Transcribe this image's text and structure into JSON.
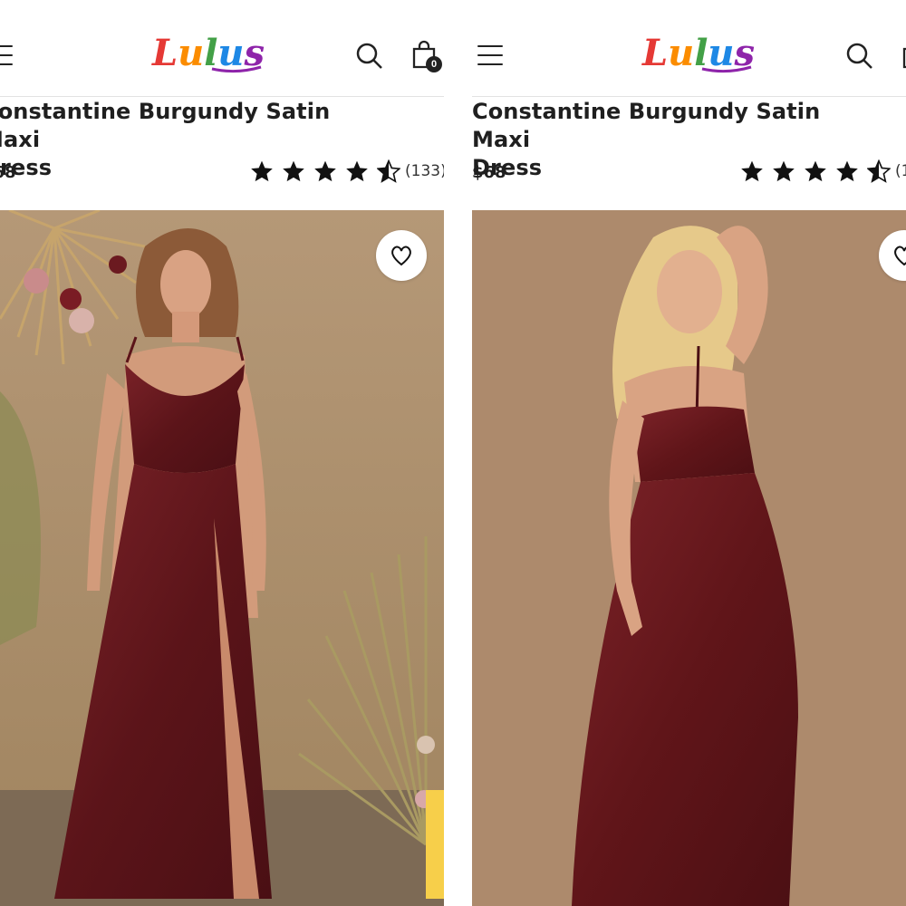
{
  "brand": {
    "logo_text": "Lulus",
    "logo_colors": [
      "#e53935",
      "#fb8c00",
      "#fdd835",
      "#43a047",
      "#1e88e5",
      "#8e24aa"
    ]
  },
  "cart": {
    "count": "0"
  },
  "icons": {
    "menu": "hamburger-menu-icon",
    "search": "search-icon",
    "bag": "shopping-bag-icon",
    "wishlist": "heart-icon",
    "star_full": "star-full-icon",
    "star_half": "star-half-icon"
  },
  "product": {
    "title_line1": "Constantine Burgundy Satin Maxi",
    "title_line2": "Dress",
    "price": "$68",
    "rating_value": 4.5,
    "review_count": "(133)",
    "dress_color": "#6b1a20"
  },
  "panels": [
    {
      "id": "left",
      "image_description": "front-view"
    },
    {
      "id": "right",
      "image_description": "back-view"
    }
  ]
}
